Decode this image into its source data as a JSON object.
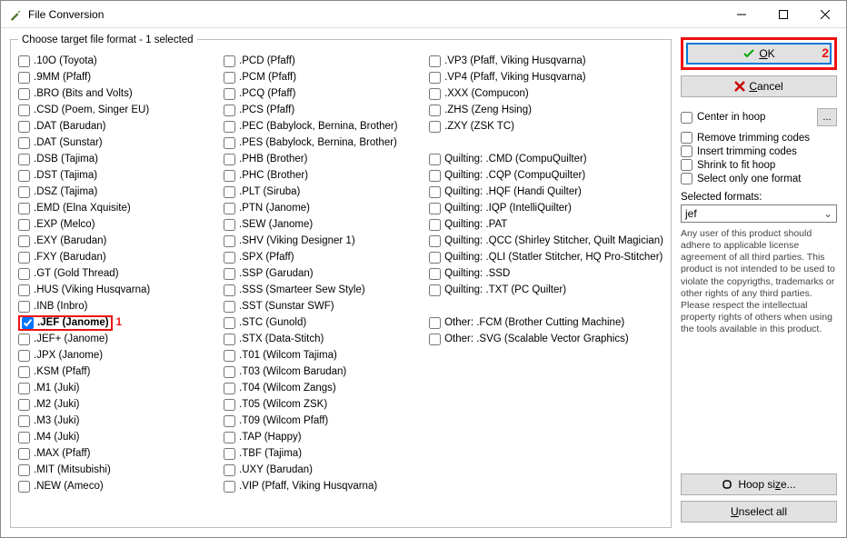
{
  "window": {
    "title": "File Conversion"
  },
  "group_label": "Choose target file format - 1 selected",
  "columns": {
    "col1": [
      {
        "label": ".10O (Toyota)",
        "checked": false
      },
      {
        "label": ".9MM (Pfaff)",
        "checked": false
      },
      {
        "label": ".BRO (Bits and Volts)",
        "checked": false
      },
      {
        "label": ".CSD (Poem, Singer EU)",
        "checked": false
      },
      {
        "label": ".DAT (Barudan)",
        "checked": false
      },
      {
        "label": ".DAT (Sunstar)",
        "checked": false
      },
      {
        "label": ".DSB (Tajima)",
        "checked": false
      },
      {
        "label": ".DST (Tajima)",
        "checked": false
      },
      {
        "label": ".DSZ (Tajima)",
        "checked": false
      },
      {
        "label": ".EMD (Elna Xquisite)",
        "checked": false
      },
      {
        "label": ".EXP (Melco)",
        "checked": false
      },
      {
        "label": ".EXY (Barudan)",
        "checked": false
      },
      {
        "label": ".FXY (Barudan)",
        "checked": false
      },
      {
        "label": ".GT (Gold Thread)",
        "checked": false
      },
      {
        "label": ".HUS (Viking Husqvarna)",
        "checked": false
      },
      {
        "label": ".INB (Inbro)",
        "checked": false
      },
      {
        "label": ".JEF (Janome)",
        "checked": true,
        "highlight": true,
        "ann": "1"
      },
      {
        "label": ".JEF+ (Janome)",
        "checked": false
      },
      {
        "label": ".JPX (Janome)",
        "checked": false
      },
      {
        "label": ".KSM (Pfaff)",
        "checked": false
      },
      {
        "label": ".M1 (Juki)",
        "checked": false
      },
      {
        "label": ".M2 (Juki)",
        "checked": false
      },
      {
        "label": ".M3 (Juki)",
        "checked": false
      },
      {
        "label": ".M4 (Juki)",
        "checked": false
      },
      {
        "label": ".MAX (Pfaff)",
        "checked": false
      },
      {
        "label": ".MIT (Mitsubishi)",
        "checked": false
      },
      {
        "label": ".NEW (Ameco)",
        "checked": false
      }
    ],
    "col2": [
      {
        "label": ".PCD (Pfaff)",
        "checked": false
      },
      {
        "label": ".PCM (Pfaff)",
        "checked": false
      },
      {
        "label": ".PCQ (Pfaff)",
        "checked": false
      },
      {
        "label": ".PCS (Pfaff)",
        "checked": false
      },
      {
        "label": ".PEC (Babylock, Bernina, Brother)",
        "checked": false
      },
      {
        "label": ".PES (Babylock, Bernina, Brother)",
        "checked": false
      },
      {
        "label": ".PHB (Brother)",
        "checked": false
      },
      {
        "label": ".PHC (Brother)",
        "checked": false
      },
      {
        "label": ".PLT (Siruba)",
        "checked": false
      },
      {
        "label": ".PTN (Janome)",
        "checked": false
      },
      {
        "label": ".SEW (Janome)",
        "checked": false
      },
      {
        "label": ".SHV (Viking Designer 1)",
        "checked": false
      },
      {
        "label": ".SPX (Pfaff)",
        "checked": false
      },
      {
        "label": ".SSP (Garudan)",
        "checked": false
      },
      {
        "label": ".SSS (Smarteer Sew Style)",
        "checked": false
      },
      {
        "label": ".SST (Sunstar SWF)",
        "checked": false
      },
      {
        "label": ".STC (Gunold)",
        "checked": false
      },
      {
        "label": ".STX (Data-Stitch)",
        "checked": false
      },
      {
        "label": ".T01 (Wilcom Tajima)",
        "checked": false
      },
      {
        "label": ".T03 (Wilcom Barudan)",
        "checked": false
      },
      {
        "label": ".T04 (Wilcom Zangs)",
        "checked": false
      },
      {
        "label": ".T05 (Wilcom ZSK)",
        "checked": false
      },
      {
        "label": ".T09 (Wilcom Pfaff)",
        "checked": false
      },
      {
        "label": ".TAP (Happy)",
        "checked": false
      },
      {
        "label": ".TBF (Tajima)",
        "checked": false
      },
      {
        "label": ".UXY (Barudan)",
        "checked": false
      },
      {
        "label": ".VIP (Pfaff, Viking Husqvarna)",
        "checked": false
      }
    ],
    "col3": [
      {
        "label": ".VP3 (Pfaff, Viking Husqvarna)",
        "checked": false
      },
      {
        "label": ".VP4 (Pfaff, Viking Husqvarna)",
        "checked": false
      },
      {
        "label": ".XXX (Compucon)",
        "checked": false
      },
      {
        "label": ".ZHS (Zeng Hsing)",
        "checked": false
      },
      {
        "label": ".ZXY (ZSK TC)",
        "checked": false
      },
      {
        "label": "",
        "blank": true
      },
      {
        "label": "Quilting: .CMD (CompuQuilter)",
        "checked": false
      },
      {
        "label": "Quilting: .CQP (CompuQuilter)",
        "checked": false
      },
      {
        "label": "Quilting: .HQF (Handi Quilter)",
        "checked": false
      },
      {
        "label": "Quilting: .IQP (IntelliQuilter)",
        "checked": false
      },
      {
        "label": "Quilting: .PAT",
        "checked": false
      },
      {
        "label": "Quilting: .QCC (Shirley Stitcher, Quilt Magician)",
        "checked": false
      },
      {
        "label": "Quilting: .QLI (Statler Stitcher, HQ Pro-Stitcher)",
        "checked": false
      },
      {
        "label": "Quilting: .SSD",
        "checked": false
      },
      {
        "label": "Quilting: .TXT (PC Quilter)",
        "checked": false
      },
      {
        "label": "",
        "blank": true
      },
      {
        "label": "Other: .FCM (Brother Cutting Machine)",
        "checked": false
      },
      {
        "label": "Other: .SVG (Scalable Vector Graphics)",
        "checked": false
      }
    ]
  },
  "right": {
    "ok_label": "OK",
    "ok_ann": "2",
    "cancel_label": "Cancel",
    "center_in_hoop": "Center in hoop",
    "browse": "...",
    "opts": [
      "Remove trimming codes",
      "Insert trimming codes",
      "Shrink to fit hoop",
      "Select only one format"
    ],
    "selected_label": "Selected formats:",
    "selected_value": "jef",
    "disclaimer": "Any user of this product should adhere to applicable license agreement of all third parties. This product is not intended to be used to violate the copyrigths, trademarks or other rights of any third parties. Please respect the intellectual property rights of others when using the tools available in this product.",
    "hoop_size": "Hoop size...",
    "unselect_all": "Unselect all"
  }
}
